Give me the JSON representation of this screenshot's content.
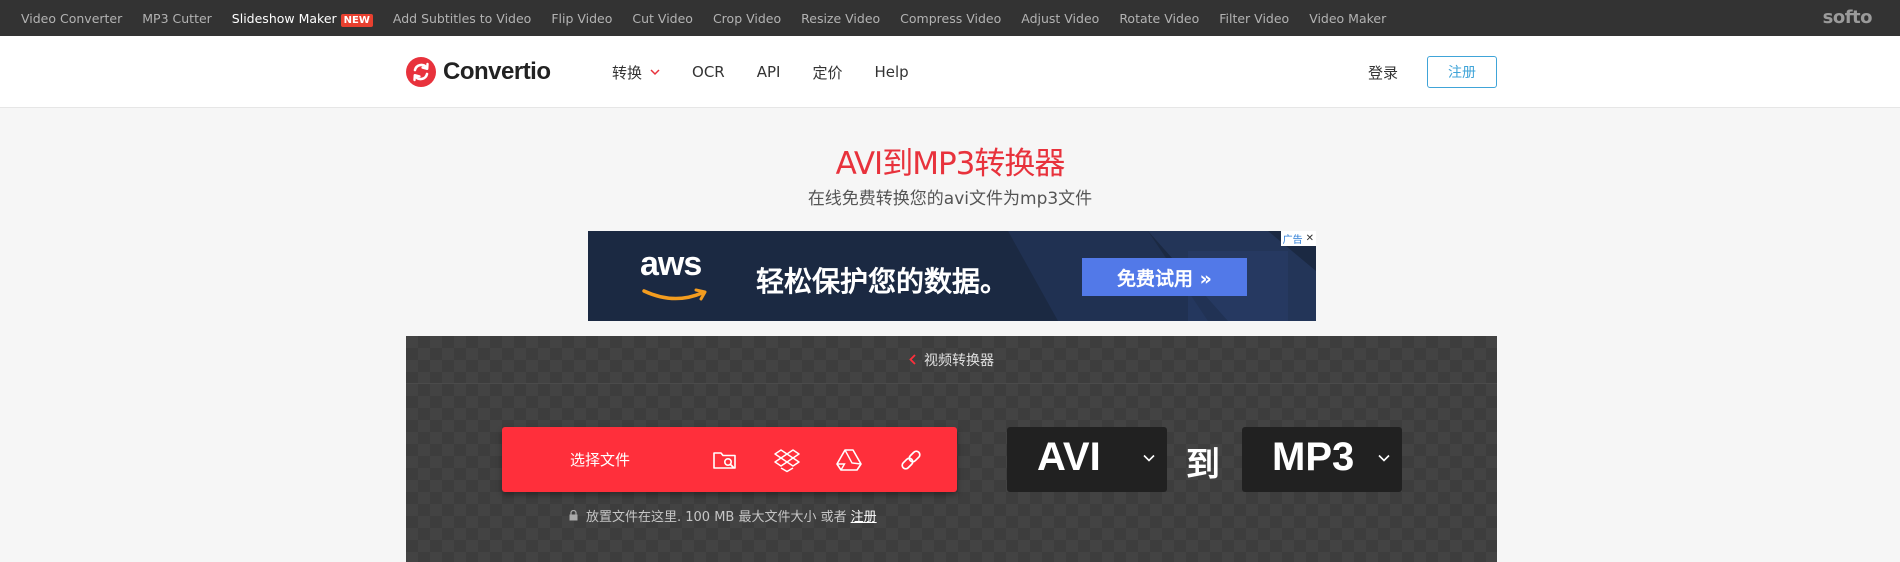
{
  "softo_bar": {
    "links": [
      {
        "label": "Video Converter",
        "active": false
      },
      {
        "label": "MP3 Cutter",
        "active": false
      },
      {
        "label": "Slideshow Maker",
        "active": true,
        "badge": "NEW"
      },
      {
        "label": "Add Subtitles to Video",
        "active": false
      },
      {
        "label": "Flip Video",
        "active": false
      },
      {
        "label": "Cut Video",
        "active": false
      },
      {
        "label": "Crop Video",
        "active": false
      },
      {
        "label": "Resize Video",
        "active": false
      },
      {
        "label": "Compress Video",
        "active": false
      },
      {
        "label": "Adjust Video",
        "active": false
      },
      {
        "label": "Rotate Video",
        "active": false
      },
      {
        "label": "Filter Video",
        "active": false
      },
      {
        "label": "Video Maker",
        "active": false
      }
    ],
    "logo": "softo"
  },
  "header": {
    "logo_text": "Convertio",
    "nav": [
      {
        "label": "转换",
        "has_dropdown": true
      },
      {
        "label": "OCR",
        "has_dropdown": false
      },
      {
        "label": "API",
        "has_dropdown": false
      },
      {
        "label": "定价",
        "has_dropdown": false
      },
      {
        "label": "Help",
        "has_dropdown": false
      }
    ],
    "login": "登录",
    "signup": "注册"
  },
  "hero": {
    "title": "AVI到MP3转换器",
    "subtitle": "在线免费转换您的avi文件为mp3文件"
  },
  "ad": {
    "brand": "aws",
    "headline": "轻松保护您的数据。",
    "cta": "免费试用 »",
    "label": "广告",
    "close": "✕"
  },
  "converter": {
    "breadcrumb": "视频转换器",
    "choose_files": "选择文件",
    "sources": [
      "folder-search-icon",
      "dropbox-icon",
      "google-drive-icon",
      "url-link-icon"
    ],
    "hint_text": "放置文件在这里. 100 MB 最大文件大小 或者",
    "hint_link": "注册",
    "from_format": "AVI",
    "to_word": "到",
    "to_format": "MP3"
  },
  "colors": {
    "brand_red": "#ff2f3b",
    "title_red": "#e8323c",
    "signup_blue": "#40a4d8",
    "ad_cta_blue": "#5279e8"
  }
}
